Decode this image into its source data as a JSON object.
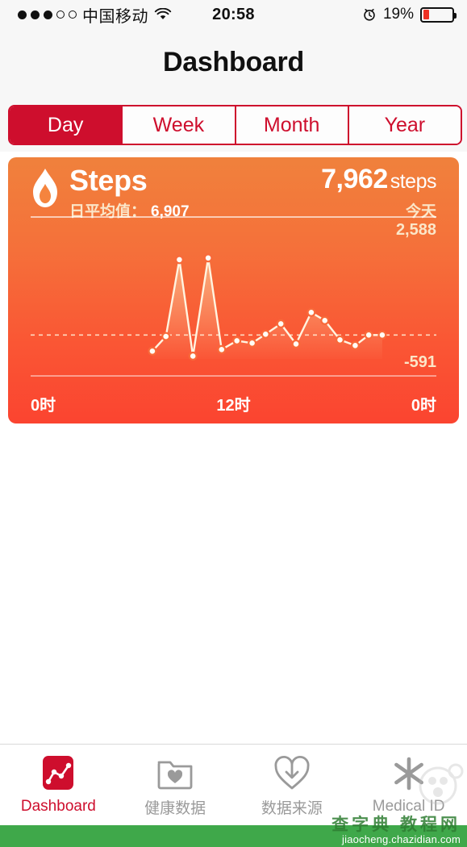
{
  "statusbar": {
    "signal_filled": 3,
    "signal_empty": 2,
    "carrier": "中国移动",
    "wifi_icon": "wifi-icon",
    "time": "20:58",
    "alarm_icon": "alarm-clock-icon",
    "battery_percent": "19%",
    "battery_level": 19,
    "battery_color": "#EE3124"
  },
  "navbar": {
    "title": "Dashboard"
  },
  "segments": {
    "items": [
      {
        "label": "Day",
        "selected": true
      },
      {
        "label": "Week",
        "selected": false
      },
      {
        "label": "Month",
        "selected": false
      },
      {
        "label": "Year",
        "selected": false
      }
    ],
    "accent_color": "#CE0E2D"
  },
  "card": {
    "icon": "flame-icon",
    "title": "Steps",
    "average_label": "日平均值：",
    "average_value": "6,907",
    "total_value": "7,962",
    "total_unit": "steps",
    "period": "今天",
    "axis_max": "2,588",
    "axis_min": "-591",
    "ticks": {
      "left": "0时",
      "center": "12时",
      "right": "0时"
    },
    "gradient_top": "#F0813C",
    "gradient_bottom": "#FB4430"
  },
  "chart_data": {
    "type": "line",
    "title": "Steps",
    "xlabel": "",
    "ylabel": "",
    "ylim": [
      -591,
      2588
    ],
    "grid": false,
    "baseline": 0,
    "legend": null,
    "xtick_labels": [
      "0时",
      "12时",
      "0时"
    ],
    "x": [
      7.2,
      8.0,
      8.8,
      9.6,
      10.5,
      11.3,
      12.2,
      13.1,
      13.9,
      14.8,
      15.7,
      16.6,
      17.4,
      18.3,
      19.2,
      20.0,
      20.8
    ],
    "values": [
      -399,
      -37,
      1855,
      -519,
      1896,
      -359,
      -141,
      -200,
      18,
      276,
      -221,
      555,
      356,
      -120,
      -259,
      0,
      0
    ],
    "marker": "circle-open",
    "line_color": "#FFF4E0",
    "fill": true
  },
  "tabbar": {
    "items": [
      {
        "label": "Dashboard",
        "icon": "dashboard-chart-icon",
        "active": true
      },
      {
        "label": "健康数据",
        "icon": "folder-heart-icon",
        "active": false
      },
      {
        "label": "数据来源",
        "icon": "heart-download-icon",
        "active": false
      },
      {
        "label": "Medical ID",
        "icon": "medical-star-icon",
        "active": false
      }
    ],
    "active_color": "#CE0E2D",
    "inactive_color": "#9a9a9a"
  },
  "watermark": {
    "text_cn": "查字典 教程网",
    "url": "jiaocheng.chazidian.com",
    "bar_color": "#3FA84A"
  }
}
